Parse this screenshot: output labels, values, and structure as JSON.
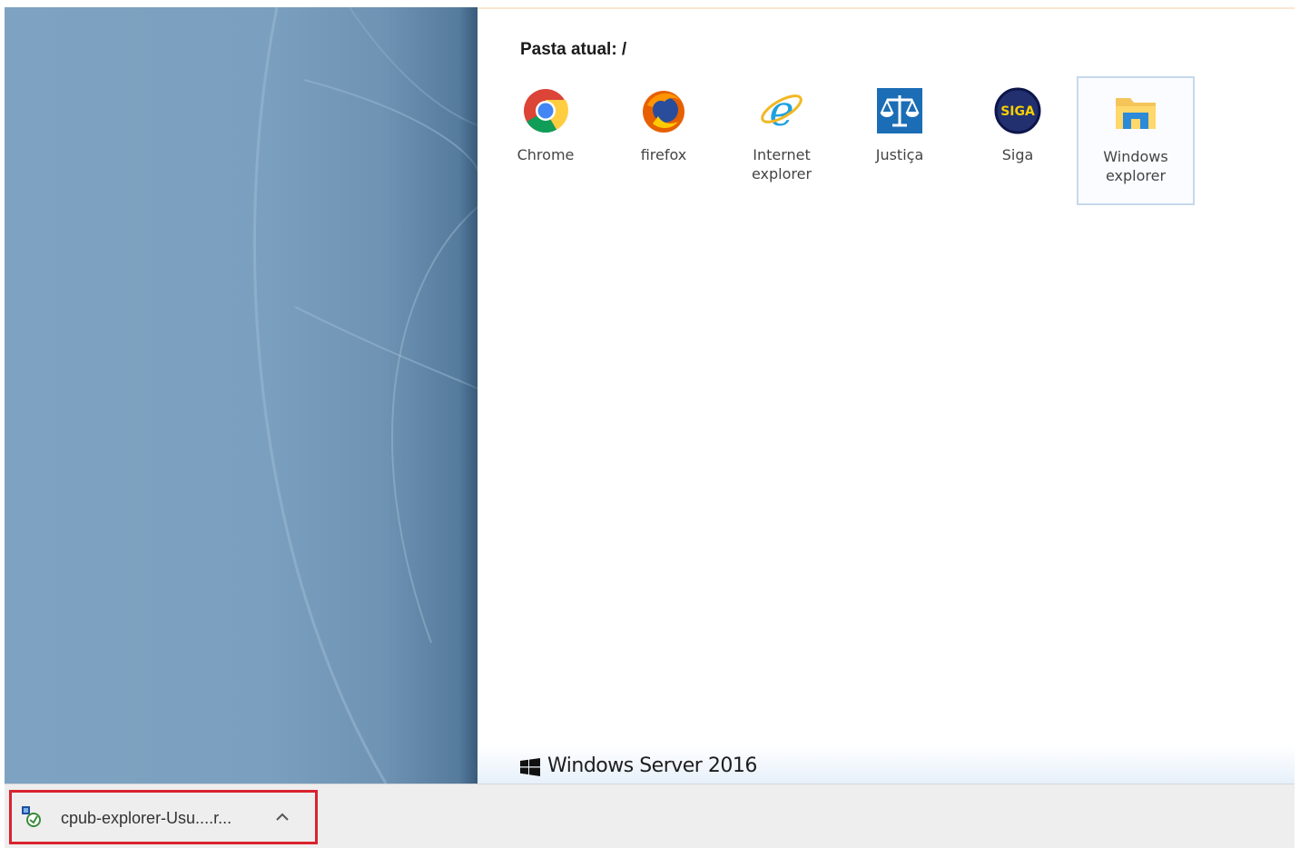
{
  "folder": {
    "label": "Pasta atual: /"
  },
  "apps": [
    {
      "label": "Chrome",
      "icon": "chrome-icon"
    },
    {
      "label": "firefox",
      "icon": "firefox-icon"
    },
    {
      "label": "Internet\nexplorer",
      "icon": "internet-explorer-icon"
    },
    {
      "label": "Justiça",
      "icon": "justice-scale-icon"
    },
    {
      "label": "Siga",
      "icon": "siga-icon",
      "icon_text": "SIGA"
    },
    {
      "label": "Windows\nexplorer",
      "icon": "folder-icon",
      "selected": true
    }
  ],
  "footer": {
    "os_text": "Windows Server 2016",
    "icon": "windows-logo-icon"
  },
  "download": {
    "filename": "cpub-explorer-Usu....r...",
    "icon": "rdp-file-icon",
    "menu_icon": "chevron-up-icon"
  },
  "colors": {
    "wallpaper": "#7ea3c2",
    "download_highlight": "#d9232e",
    "download_bar": "#eeeeee"
  }
}
